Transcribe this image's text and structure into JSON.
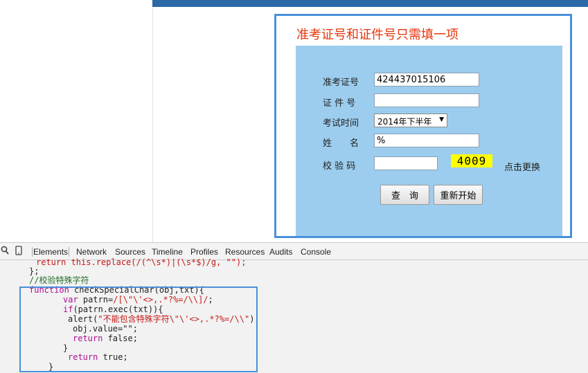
{
  "form": {
    "title": "准考证号和证件号只需填一项",
    "exam_no_label": "准考证号",
    "exam_no_value": "424437015106",
    "id_label": "证 件 号",
    "id_value": "",
    "exam_time_label": "考试时间",
    "exam_time_selected": "2014年下半年",
    "name_label": "姓　　名",
    "name_value": "%",
    "captcha_label": "校 验 码",
    "captcha_value": "",
    "captcha_text": "4009",
    "refresh_text": "点击更换",
    "query_button": "查　询",
    "reset_button": "重新开始"
  },
  "devtools": {
    "tabs": [
      "Elements",
      "Network",
      "Sources",
      "Timeline",
      "Profiles",
      "Resources",
      "Audits",
      "Console"
    ],
    "active_tab": "Elements",
    "code": {
      "line0": "return this.replace(/(^\\s*)|(\\s*$)/g, \"\");",
      "line1": "};",
      "line2": "//校验特殊字符",
      "line3_kw": "function",
      "line3_rest": " checkSpecialChar(obj,txt){",
      "line4_kw": "var",
      "line4_rest": " patrn=",
      "line4_str": "/[\\\"\\'<>,.*?%=/\\\\]/",
      "line4_end": ";",
      "line5_kw": "if",
      "line5_rest": "(patrn.exec(txt)){",
      "line6_a": "alert(",
      "line6_str": "\"不能包含特殊字符\\\"\\'<>,.*?%=/\\\\\"",
      "line6_end": ");",
      "line7": "obj.value=\"\";",
      "line8_kw": "return",
      "line8_rest": " false;",
      "line9": "}",
      "line10_kw": "return",
      "line10_rest": " true;",
      "line11": "}"
    }
  },
  "colors": {
    "title_red": "#e8340c",
    "panel_blue": "#9ccdee",
    "frame_blue": "#4a90d9",
    "captcha_yellow": "#ffff00",
    "top_bar": "#2b6aa6"
  }
}
